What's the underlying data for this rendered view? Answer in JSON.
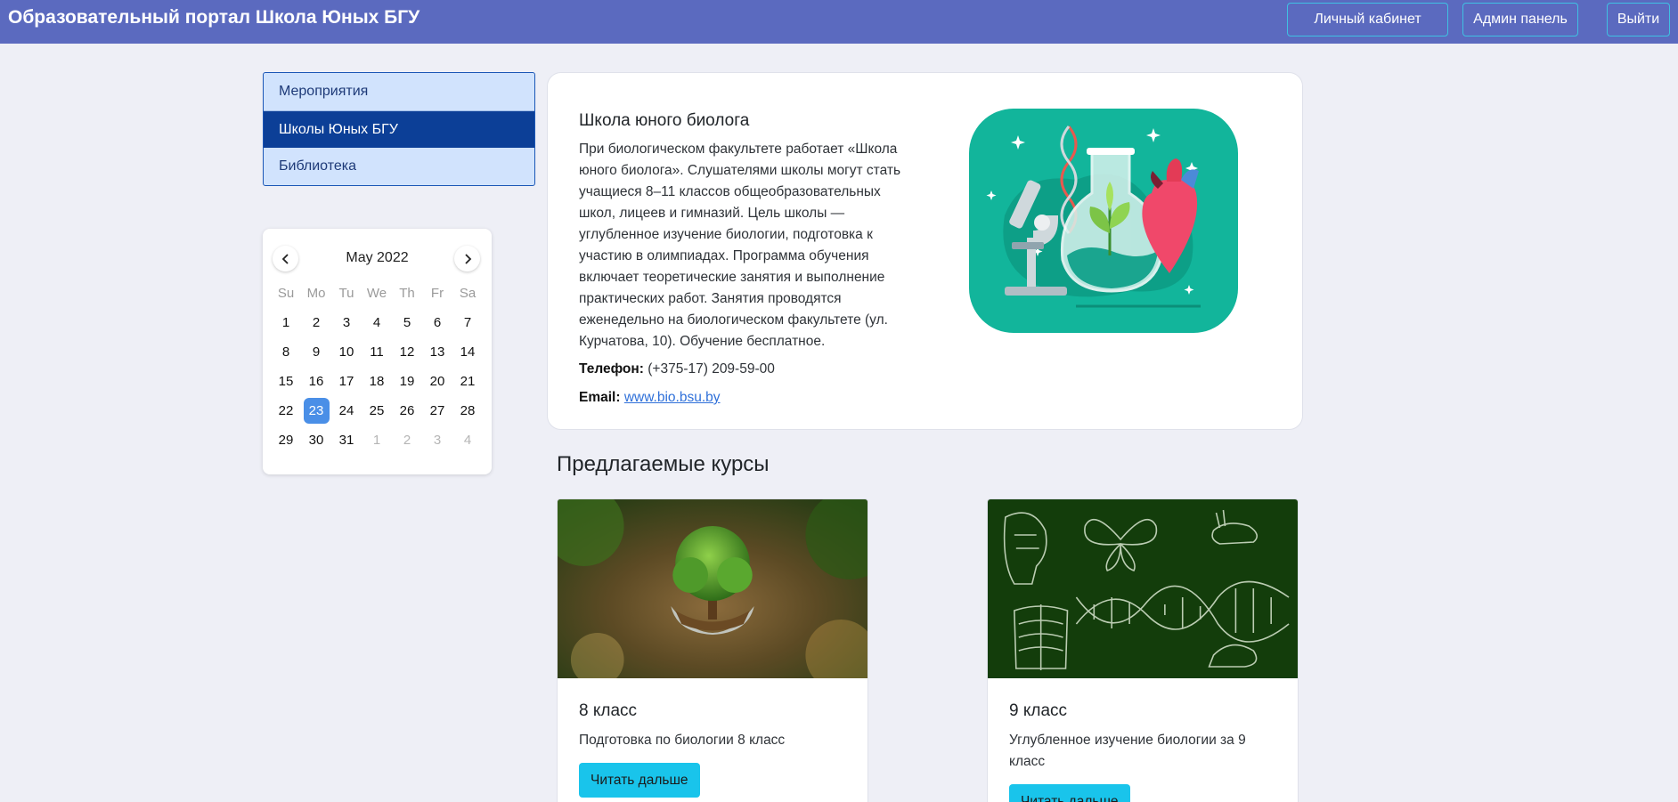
{
  "navbar": {
    "brand": "Образовательный портал Школа Юных БГУ",
    "buttons": [
      "Личный кабинет",
      "Админ панель",
      "Выйти"
    ]
  },
  "side_menu": {
    "items": [
      {
        "label": "Мероприятия",
        "active": false
      },
      {
        "label": "Школы Юных БГУ",
        "active": true
      },
      {
        "label": "Библиотека",
        "active": false
      }
    ]
  },
  "calendar": {
    "month_label": "May 2022",
    "weekdays": [
      "Su",
      "Mo",
      "Tu",
      "We",
      "Th",
      "Fr",
      "Sa"
    ],
    "selected_day": "23",
    "weeks": [
      [
        "1",
        "2",
        "3",
        "4",
        "5",
        "6",
        "7"
      ],
      [
        "8",
        "9",
        "10",
        "11",
        "12",
        "13",
        "14"
      ],
      [
        "15",
        "16",
        "17",
        "18",
        "19",
        "20",
        "21"
      ],
      [
        "22",
        "23",
        "24",
        "25",
        "26",
        "27",
        "28"
      ],
      [
        "29",
        "30",
        "31",
        "1",
        "2",
        "3",
        "4"
      ]
    ],
    "next_month_days_in_last_week": 4
  },
  "school": {
    "title": "Школа юного биолога",
    "description": "При биологическом факультете работает «Школа юного биолога». Слушателями школы могут стать учащиеся 8–11 классов общеобразовательных школ, лицеев и гимназий. Цель школы — углубленное изучение биологии, подготовка к участию в олимпиадах. Программа обучения включает теоретические занятия и выполнение практических работ. Занятия проводятся еженедельно на биологическом факультете (ул. Курчатова, 10). Обучение бесплатное.",
    "phone_label": "Телефон:",
    "phone": "(+375-17) 209-59-00",
    "email_label": "Email:",
    "email": "www.bio.bsu.by"
  },
  "courses": {
    "heading": "Предлагаемые курсы",
    "items": [
      {
        "title": "8 класс",
        "description": "Подготовка по биологии 8 класс",
        "button": "Читать дальше"
      },
      {
        "title": "9 класс",
        "description": "Углубленное изучение биологии за 9 класс",
        "button": "Читать дальше"
      }
    ]
  },
  "colors": {
    "navbar": "#5b6abf",
    "menu_active": "#0c3f97",
    "menu_bg": "#d1e3fd",
    "calendar_selected": "#4a8fe7",
    "button_primary": "#19c4eb",
    "illustration_bg": "#12b59b"
  }
}
